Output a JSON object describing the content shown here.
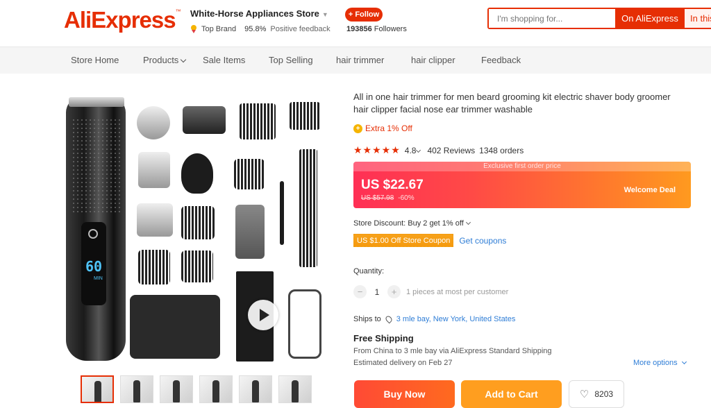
{
  "header": {
    "logo": "AliExpress",
    "store_name": "White-Horse Appliances Store",
    "top_brand": "Top Brand",
    "feedback_value": "95.8%",
    "feedback_label": "Positive feedback",
    "follow_label": "+ Follow",
    "followers_count": "193856",
    "followers_label": "Followers",
    "search_placeholder": "I'm shopping for...",
    "search_btn_ali": "On AliExpress",
    "search_btn_store": "In this store"
  },
  "nav": {
    "items": [
      "Store Home",
      "Products",
      "Sale Items",
      "Top Selling",
      "hair trimmer",
      "hair clipper",
      "Feedback"
    ]
  },
  "product": {
    "title": "All in one hair trimmer for men beard grooming kit electric shaver body groomer hair clipper facial nose ear trimmer washable",
    "extra_off": "Extra 1% Off",
    "rating": "4.8",
    "reviews": "402 Reviews",
    "orders": "1348 orders",
    "exclusive_label": "Exclusive first order price",
    "price": "US $22.67",
    "original_price": "US $57.98",
    "discount_pct": "-60%",
    "welcome_deal": "Welcome Deal",
    "store_discount": "Store Discount: Buy 2 get 1% off",
    "coupon": "US $1.00 Off Store Coupon",
    "get_coupons": "Get coupons",
    "quantity_label": "Quantity:",
    "quantity_value": "1",
    "quantity_note": "1 pieces at most per customer",
    "ships_to_label": "Ships to",
    "ships_to_location": "3 mle bay, New York, United States",
    "free_shipping": "Free Shipping",
    "from_text": "From China to 3 mle bay via AliExpress Standard Shipping",
    "delivery": "Estimated delivery on Feb 27",
    "more_options": "More options",
    "buy_now": "Buy Now",
    "add_to_cart": "Add to Cart",
    "wishlist_count": "8203"
  },
  "colors": {
    "brand": "#e62e04",
    "link": "#2e7dd6",
    "cart": "#ff9e1f"
  }
}
